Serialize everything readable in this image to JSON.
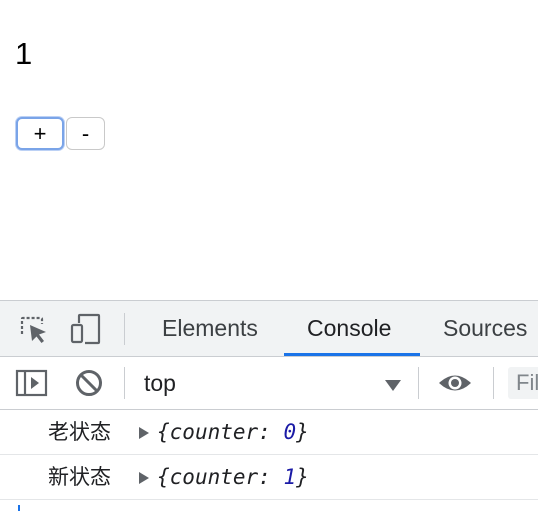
{
  "app": {
    "counter": "1",
    "increment_label": "+",
    "decrement_label": "-"
  },
  "devtools": {
    "tabs": [
      "Elements",
      "Console",
      "Sources"
    ],
    "active_tab": "Console",
    "context": "top",
    "filter_placeholder": "Filter",
    "logs": [
      {
        "label": "老状态",
        "key": "counter",
        "value": "0"
      },
      {
        "label": "新状态",
        "key": "counter",
        "value": "1"
      }
    ],
    "icons": [
      "inspect-element-icon",
      "device-toggle-icon",
      "sidebar-toggle-icon",
      "clear-console-icon",
      "eye-icon"
    ],
    "accent_color": "#1a73e8",
    "number_color": "#1a1aa6"
  }
}
